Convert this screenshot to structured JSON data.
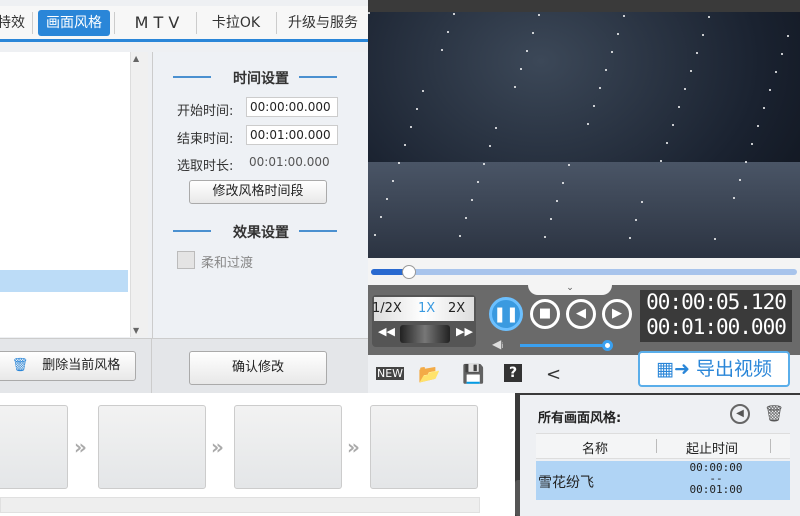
{
  "tabs": [
    {
      "label": "特效"
    },
    {
      "label": "画面风格",
      "active": true
    },
    {
      "label": "M T V"
    },
    {
      "label": "卡拉OK"
    },
    {
      "label": "升级与服务"
    }
  ],
  "time_settings": {
    "title": "时间设置",
    "start_label": "开始时间:",
    "start_value": "00:00:00.000",
    "end_label": "结束时间:",
    "end_value": "00:01:00.000",
    "duration_label": "选取时长:",
    "duration_value": "00:01:00.000",
    "modify_button": "修改风格时间段"
  },
  "effect_settings": {
    "title": "效果设置",
    "smooth_label": "柔和过渡",
    "smooth_checked": false
  },
  "delete_button": "删除当前风格",
  "confirm_button": "确认修改",
  "player": {
    "progress": 0.09,
    "speeds": [
      "1/2X",
      "1X",
      "2X"
    ],
    "active_speed": "1X",
    "current_time": "00:00:05.120",
    "total_time": "00:01:00.000",
    "volume": 1.0
  },
  "export_button": "导出视频",
  "styles_panel": {
    "title": "所有画面风格:",
    "columns": [
      "名称",
      "起止时间"
    ],
    "rows": [
      {
        "name": "雪花纷飞",
        "start": "00:00:00",
        "sep": "--",
        "end": "00:01:00"
      }
    ]
  },
  "colors": {
    "accent": "#2a86d8",
    "selected": "#b0d4f5"
  }
}
